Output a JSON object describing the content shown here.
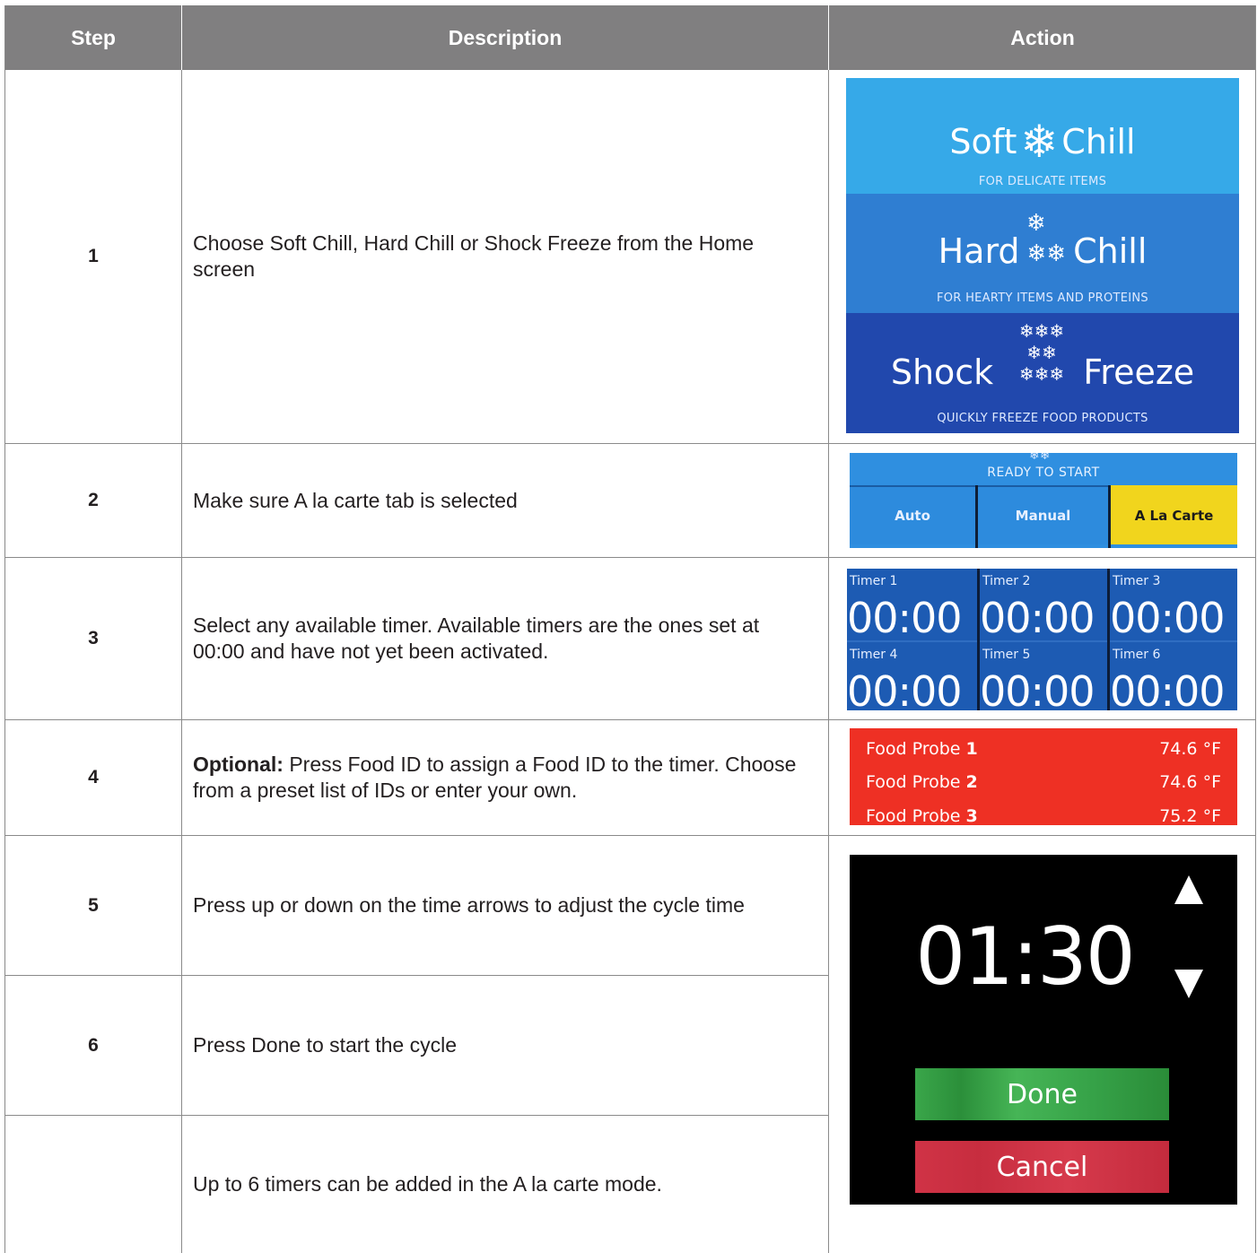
{
  "table": {
    "headers": {
      "step": "Step",
      "description": "Description",
      "action": "Action"
    },
    "rows": [
      {
        "step": "1",
        "description": "Choose Soft Chill, Hard Chill or Shock Freeze from the Home screen"
      },
      {
        "step": "2",
        "description": "Make sure A la carte tab is selected"
      },
      {
        "step": "3",
        "description": "Select any available timer. Available timers are the ones set at 00:00 and have not yet been activated."
      },
      {
        "step": "4",
        "description_bold": "Optional:",
        "description": " Press Food ID to assign a Food ID to the timer. Choose from a preset list of IDs or enter your own."
      },
      {
        "step": "5",
        "description": "Press up or down on the time arrows to adjust the cycle time"
      },
      {
        "step": "6",
        "description": "Press Done to start the cycle"
      },
      {
        "step": "",
        "description": "Up to 6 timers can be added in the A la carte mode."
      }
    ]
  },
  "screens": {
    "modes": {
      "colors": {
        "soft": "#36a9e8",
        "hard": "#2f7ed2",
        "shock": "#2148ad"
      },
      "soft": {
        "left": "Soft",
        "right": "Chill",
        "sub": "FOR DELICATE ITEMS"
      },
      "hard": {
        "left": "Hard",
        "right": "Chill",
        "sub": "FOR HEARTY ITEMS AND PROTEINS"
      },
      "shock": {
        "left": "Shock",
        "right": "Freeze",
        "sub": "QUICKLY FREEZE FOOD PRODUCTS"
      }
    },
    "tabs": {
      "status": "READY TO START",
      "items": [
        "Auto",
        "Manual",
        "A La Carte"
      ],
      "selected": "A La Carte",
      "selected_color": "#f1d51d"
    },
    "timers": [
      {
        "label": "Timer 1",
        "value": "00:00"
      },
      {
        "label": "Timer 2",
        "value": "00:00"
      },
      {
        "label": "Timer 3",
        "value": "00:00"
      },
      {
        "label": "Timer 4",
        "value": "00:00"
      },
      {
        "label": "Timer 5",
        "value": "00:00"
      },
      {
        "label": "Timer 6",
        "value": "00:00"
      }
    ],
    "probes": [
      {
        "label": "Food Probe",
        "num": "1",
        "temp": "74.6 °F"
      },
      {
        "label": "Food Probe",
        "num": "2",
        "temp": "74.6 °F"
      },
      {
        "label": "Food Probe",
        "num": "3",
        "temp": "75.2 °F"
      }
    ],
    "timeset": {
      "time": "01:30",
      "done": "Done",
      "cancel": "Cancel",
      "icons": [
        "arrow-up-icon",
        "arrow-down-icon"
      ]
    }
  }
}
